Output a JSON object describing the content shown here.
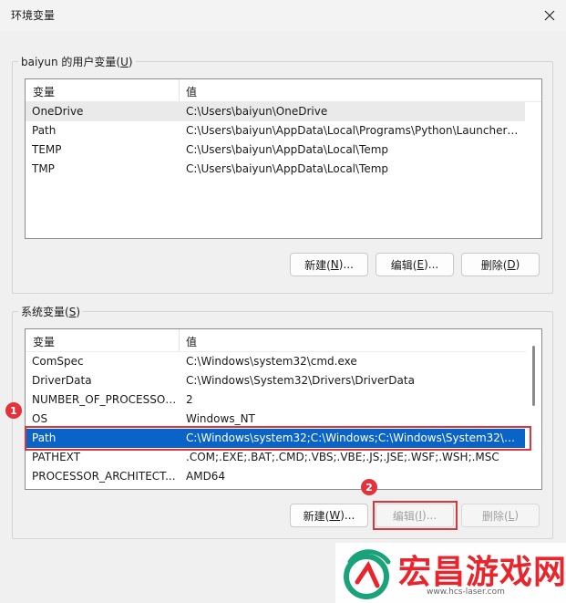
{
  "window": {
    "title": "环境变量"
  },
  "user_vars": {
    "group_label": "baiyun 的用户变量(",
    "group_hotkey": "U",
    "group_label_end": ")",
    "col_name": "变量",
    "col_value": "值",
    "rows": [
      {
        "name": "OneDrive",
        "value": "C:\\Users\\baiyun\\OneDrive"
      },
      {
        "name": "Path",
        "value": "C:\\Users\\baiyun\\AppData\\Local\\Programs\\Python\\Launcher\\;..."
      },
      {
        "name": "TEMP",
        "value": "C:\\Users\\baiyun\\AppData\\Local\\Temp"
      },
      {
        "name": "TMP",
        "value": "C:\\Users\\baiyun\\AppData\\Local\\Temp"
      }
    ],
    "buttons": {
      "new": {
        "pre": "新建(",
        "hotkey": "N",
        "post": ")..."
      },
      "edit": {
        "pre": "编辑(",
        "hotkey": "E",
        "post": ")..."
      },
      "delete": {
        "pre": "删除(",
        "hotkey": "D",
        "post": ")"
      }
    }
  },
  "system_vars": {
    "group_label": "系统变量(",
    "group_hotkey": "S",
    "group_label_end": ")",
    "col_name": "变量",
    "col_value": "值",
    "rows": [
      {
        "name": "ComSpec",
        "value": "C:\\Windows\\system32\\cmd.exe"
      },
      {
        "name": "DriverData",
        "value": "C:\\Windows\\System32\\Drivers\\DriverData"
      },
      {
        "name": "NUMBER_OF_PROCESSORS",
        "value": "2"
      },
      {
        "name": "OS",
        "value": "Windows_NT"
      },
      {
        "name": "Path",
        "value": "C:\\Windows\\system32;C:\\Windows;C:\\Windows\\System32\\Wb..."
      },
      {
        "name": "PATHEXT",
        "value": ".COM;.EXE;.BAT;.CMD;.VBS;.VBE;.JS;.JSE;.WSF;.WSH;.MSC"
      },
      {
        "name": "PROCESSOR_ARCHITECT...",
        "value": "AMD64"
      }
    ],
    "selected_index": 4,
    "buttons": {
      "new": {
        "pre": "新建(",
        "hotkey": "W",
        "post": ")..."
      },
      "edit": {
        "pre": "编辑(",
        "hotkey": "I",
        "post": ")..."
      },
      "delete": {
        "pre": "删除(",
        "hotkey": "L",
        "post": ")"
      }
    }
  },
  "annotations": {
    "badge1": "1",
    "badge2": "2"
  },
  "watermark": {
    "title": "宏昌游戏网",
    "url": "www.hcs-laser.com"
  },
  "colors": {
    "selection": "#0a64c8",
    "annotation_red": "#d9363e",
    "watermark_red": "#e8252d"
  },
  "icons": {
    "close": "close-icon",
    "logo": "watermark-logo-icon"
  }
}
